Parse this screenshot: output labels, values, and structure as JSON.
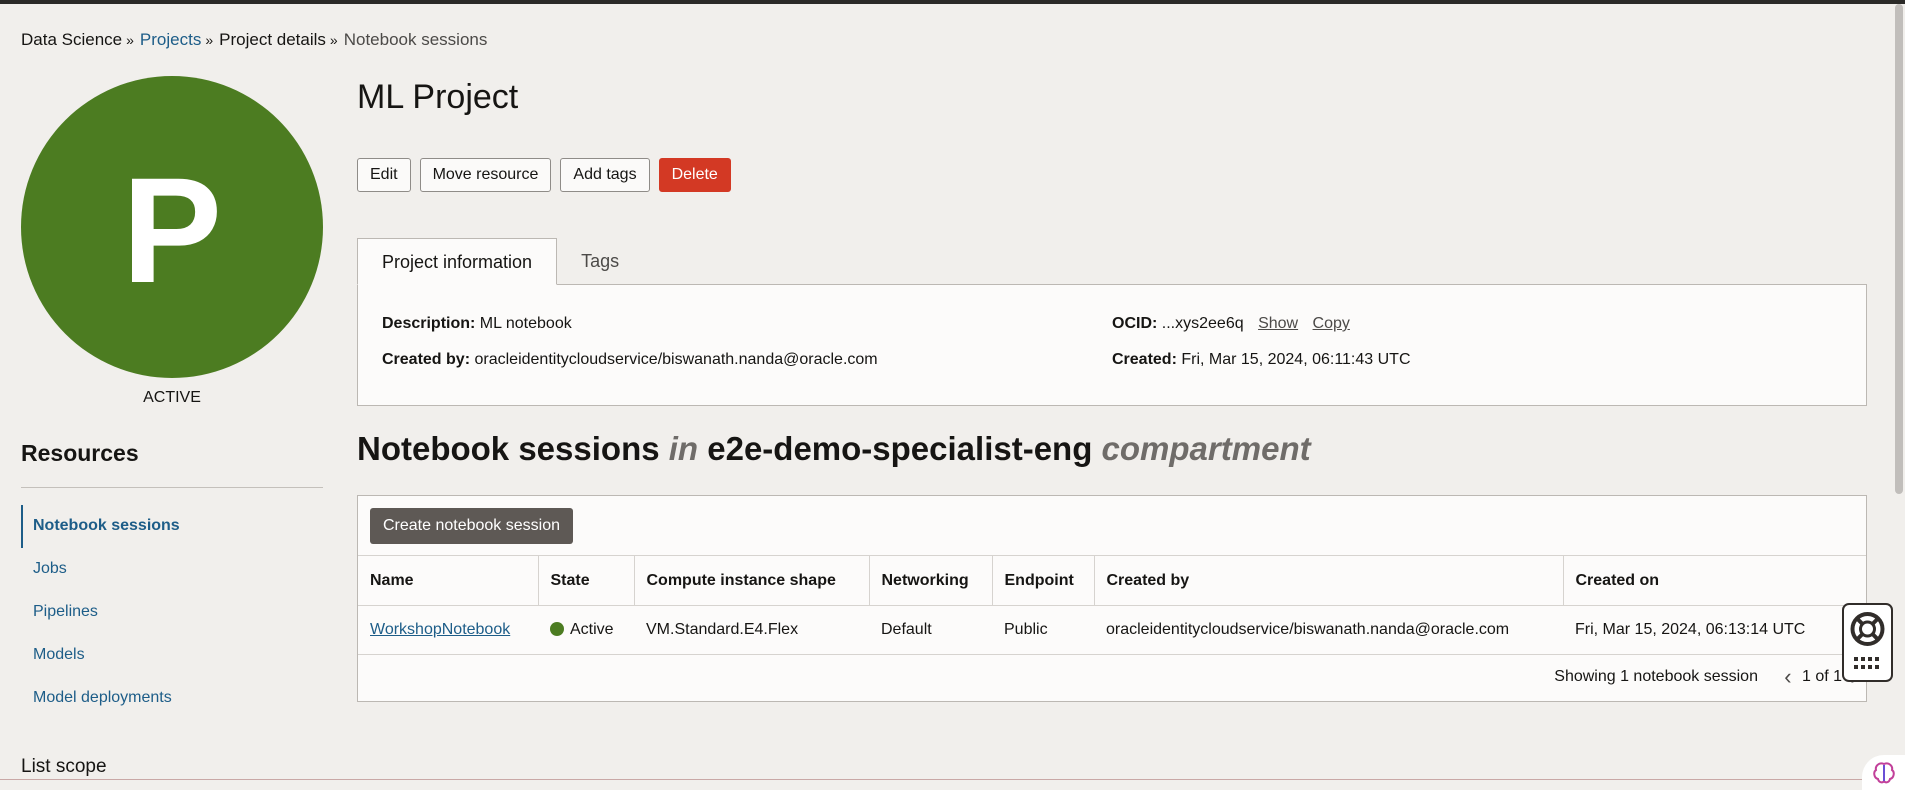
{
  "breadcrumb": {
    "items": [
      "Data Science",
      "Projects",
      "Project details",
      "Notebook sessions"
    ]
  },
  "project": {
    "avatar_letter": "P",
    "status": "ACTIVE",
    "title": "ML Project"
  },
  "actions": {
    "edit": "Edit",
    "move": "Move resource",
    "add_tags": "Add tags",
    "delete": "Delete"
  },
  "tabs": [
    "Project information",
    "Tags"
  ],
  "info": {
    "description_label": "Description:",
    "description": "ML notebook",
    "created_by_label": "Created by:",
    "created_by": "oracleidentitycloudservice/biswanath.nanda@oracle.com",
    "ocid_label": "OCID:",
    "ocid": "...xys2ee6q",
    "show": "Show",
    "copy": "Copy",
    "created_label": "Created:",
    "created": "Fri, Mar 15, 2024, 06:11:43 UTC"
  },
  "resources": {
    "heading": "Resources",
    "items": [
      "Notebook sessions",
      "Jobs",
      "Pipelines",
      "Models",
      "Model deployments"
    ],
    "list_scope": "List scope"
  },
  "sessions": {
    "heading_main": "Notebook sessions",
    "heading_in": "in",
    "heading_compartment": "e2e-demo-specialist-eng",
    "heading_suffix": "compartment",
    "create_button": "Create notebook session",
    "columns": [
      "Name",
      "State",
      "Compute instance shape",
      "Networking",
      "Endpoint",
      "Created by",
      "Created on"
    ],
    "rows": [
      {
        "name": "WorkshopNotebook",
        "state": "Active",
        "shape": "VM.Standard.E4.Flex",
        "networking": "Default",
        "endpoint": "Public",
        "created_by": "oracleidentitycloudservice/biswanath.nanda@oracle.com",
        "created_on": "Fri, Mar 15, 2024, 06:13:14 UTC"
      }
    ],
    "footer": "Showing 1 notebook session",
    "page": "1 of 1"
  },
  "colors": {
    "accent_green": "#4c7c21",
    "link_blue": "#1d5d88",
    "danger_red": "#d33924"
  }
}
